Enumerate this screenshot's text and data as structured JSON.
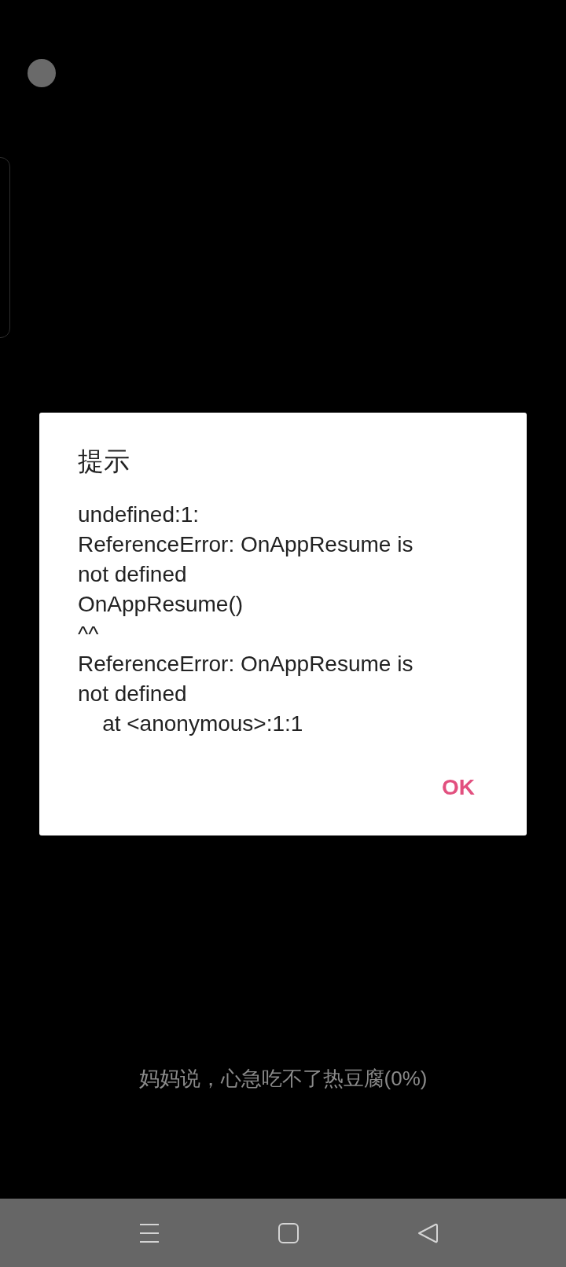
{
  "dialog": {
    "title": "提示",
    "message": "undefined:1:\nReferenceError: OnAppResume is not defined\nOnAppResume()\n^^\nReferenceError: OnAppResume is not defined\n    at <anonymous>:1:1",
    "buttons": [
      {
        "label": "OK"
      }
    ]
  },
  "loading_text": "妈妈说，心急吃不了热豆腐(0%)",
  "nav_bar": {
    "buttons": [
      {
        "kind": "menu"
      },
      {
        "kind": "home"
      },
      {
        "kind": "back"
      }
    ]
  }
}
